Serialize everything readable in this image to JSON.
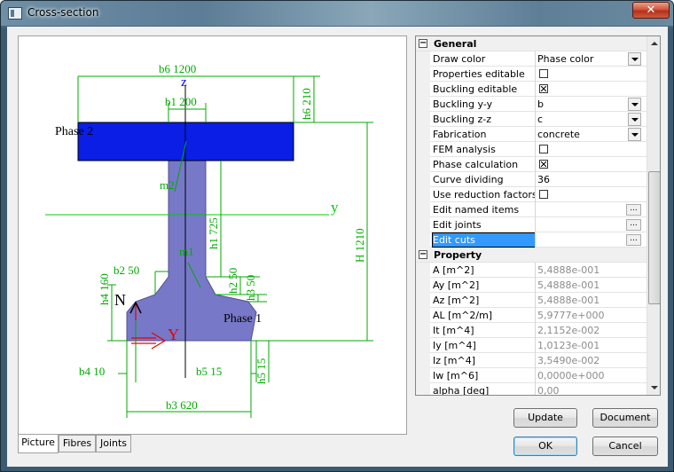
{
  "window": {
    "title": "Cross-section",
    "close_glyph": "✕"
  },
  "drawing": {
    "labels": {
      "b6": "b6 1200",
      "h6": "h6 210",
      "z": "z",
      "b1": "b1 200",
      "phase2": "Phase 2",
      "m2": "m2",
      "y": "y",
      "h1": "h1 725",
      "H": "H 1210",
      "m1": "m1",
      "h2": "h2 50",
      "h3": "h3 50",
      "b2": "b2 50",
      "h4": "h4 160",
      "N": "N",
      "Y": "Y",
      "phase1": "Phase 1",
      "b4": "b4 10",
      "b5": "b5 15",
      "h5": "h5 15",
      "b3": "b3 620"
    },
    "colors": {
      "dimension": "#00aa00",
      "phase2": "#0a1ee6",
      "phase1": "#7878c8",
      "axis_y": "#00cc00",
      "axis_z": "#0000ff",
      "red_arrow": "#e60000"
    }
  },
  "tabs": [
    {
      "label": "Picture"
    },
    {
      "label": "Fibres"
    },
    {
      "label": "Joints"
    }
  ],
  "properties": {
    "general": {
      "label": "General",
      "rows": [
        {
          "name": "Draw color",
          "value": "Phase color",
          "editor": "dropdown"
        },
        {
          "name": "Properties editable",
          "value": "",
          "editor": "checkbox",
          "checked": false
        },
        {
          "name": "Buckling editable",
          "value": "",
          "editor": "checkbox",
          "checked": true
        },
        {
          "name": "Buckling y-y",
          "value": "b",
          "editor": "dropdown"
        },
        {
          "name": "Buckling z-z",
          "value": "c",
          "editor": "dropdown"
        },
        {
          "name": "Fabrication",
          "value": "concrete",
          "editor": "dropdown"
        },
        {
          "name": "FEM analysis",
          "value": "",
          "editor": "checkbox",
          "checked": false
        },
        {
          "name": "Phase calculation",
          "value": "",
          "editor": "checkbox",
          "checked": true
        },
        {
          "name": "Curve dividing",
          "value": "36",
          "editor": "text"
        },
        {
          "name": "Use reduction factors",
          "value": "",
          "editor": "checkbox",
          "checked": false
        },
        {
          "name": "Edit named items",
          "value": "",
          "editor": "ellipsis"
        },
        {
          "name": "Edit joints",
          "value": "",
          "editor": "ellipsis"
        },
        {
          "name": "Edit cuts",
          "value": "",
          "editor": "ellipsis",
          "selected": true
        }
      ]
    },
    "property": {
      "label": "Property",
      "rows": [
        {
          "name": "A [m^2]",
          "value": "5,4888e-001"
        },
        {
          "name": "Ay [m^2]",
          "value": "5,4888e-001"
        },
        {
          "name": "Az [m^2]",
          "value": "5,4888e-001"
        },
        {
          "name": "AL [m^2/m]",
          "value": "5,9777e+000"
        },
        {
          "name": "It [m^4]",
          "value": "2,1152e-002"
        },
        {
          "name": "Iy [m^4]",
          "value": "1,0123e-001"
        },
        {
          "name": "Iz [m^4]",
          "value": "3,5490e-002"
        },
        {
          "name": "Iw [m^6]",
          "value": "0,0000e+000"
        },
        {
          "name": "alpha [deg]",
          "value": "0,00"
        }
      ]
    },
    "expander_minus": "−",
    "ellipsis_glyph": "..."
  },
  "buttons": {
    "update": "Update",
    "document": "Document",
    "ok": "OK",
    "cancel": "Cancel"
  }
}
